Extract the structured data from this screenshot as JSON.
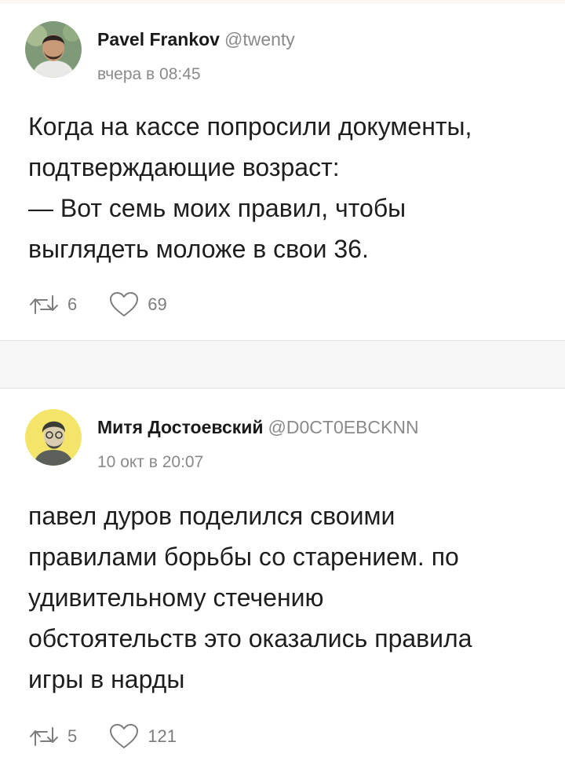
{
  "posts": [
    {
      "author_name": "Pavel Frankov",
      "author_handle": "@twenty",
      "time": "вчера в 08:45",
      "text_lines": [
        "Когда на кассе попросили документы,",
        "подтверждающие возраст:",
        "— Вот семь моих правил, чтобы",
        "выглядеть моложе в свои 36."
      ],
      "reposts": "6",
      "likes": "69"
    },
    {
      "author_name": "Митя Достоевский",
      "author_handle": "@D0CT0EBCKNN",
      "time": "10 окт в 20:07",
      "text_lines": [
        "павел дуров поделился своими",
        "правилами борьбы со старением. по",
        "удивительному стечению",
        "обстоятельств это оказались правила",
        "игры в нарды"
      ],
      "reposts": "5",
      "likes": "121"
    }
  ],
  "icons": {
    "repost": "repost-icon",
    "like": "heart-icon",
    "avatar": "avatar"
  },
  "colors": {
    "text": "#1e1e1e",
    "muted": "#8a8a8a",
    "avatar1_bg": "#7f9a78",
    "avatar2_bg": "#f4e56a"
  }
}
